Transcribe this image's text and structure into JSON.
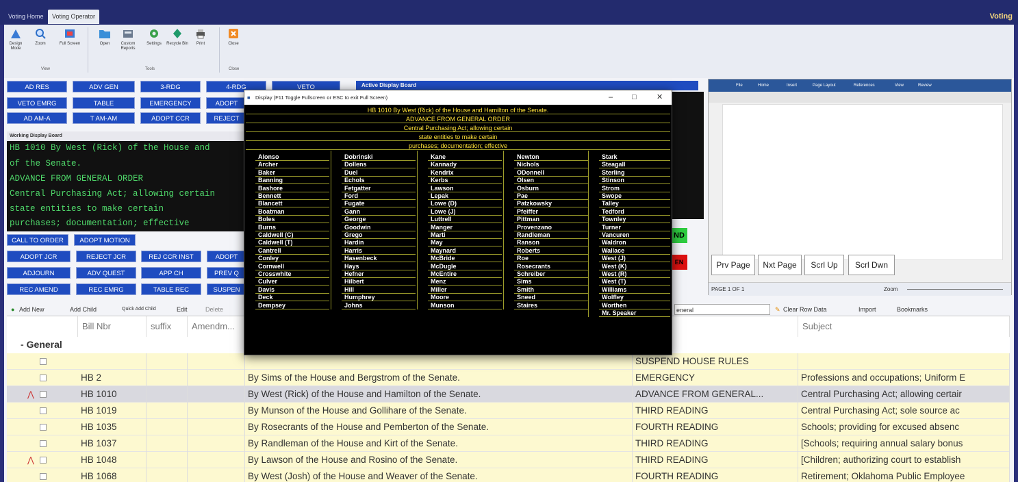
{
  "tabs": [
    "Voting Home",
    "Voting Operator"
  ],
  "app_label": "Voting",
  "ribbon": {
    "buttons": [
      {
        "label": "Design Mode",
        "icon": "design-icon"
      },
      {
        "label": "Zoom",
        "icon": "zoom-icon"
      },
      {
        "label": "Full Screen",
        "icon": "fullscreen-icon"
      },
      {
        "label": "Open",
        "icon": "folder-icon"
      },
      {
        "label": "Custom Reports",
        "icon": "report-icon"
      },
      {
        "label": "Settings",
        "icon": "settings-icon"
      },
      {
        "label": "Recycle Bin",
        "icon": "recycle-icon"
      },
      {
        "label": "Print",
        "icon": "print-icon"
      },
      {
        "label": "Close",
        "icon": "close-icon"
      }
    ],
    "groups": [
      "View",
      "Tools",
      "Close"
    ]
  },
  "vote_buttons": {
    "row1": [
      "AD RES",
      "ADV GEN",
      "3-RDG",
      "4-RDG",
      "VETO"
    ],
    "row2": [
      "VETO EMRG",
      "TABLE",
      "EMERGENCY",
      "ADOPT"
    ],
    "row3": [
      "AD AM-A",
      "T AM-AM",
      "ADOPT CCR",
      "REJECT"
    ],
    "row4": [
      "CALL TO ORDER",
      "ADOPT MOTION"
    ],
    "row5": [
      "ADOPT JCR",
      "REJECT JCR",
      "REJ CCR INST",
      "ADOPT"
    ],
    "row6": [
      "ADJOURN",
      "ADV QUEST",
      "APP CH",
      "PREV Q"
    ],
    "row7": [
      "REC AMEND",
      "REC EMRG",
      "TABLE REC",
      "SUSPEN"
    ],
    "side_green": "ND",
    "side_red": "EN"
  },
  "working_display": {
    "title": "Working Display Board",
    "lines": [
      "HB 1010  By West (Rick) of the House and",
      "of the Senate.",
      "ADVANCE FROM GENERAL ORDER",
      "Central Purchasing Act; allowing certain",
      "state entities to make certain",
      "purchases; documentation; effective"
    ]
  },
  "active_display_title": "Active Display Board",
  "word": {
    "menu": [
      "File",
      "Home",
      "Insert",
      "Page Layout",
      "References",
      "View",
      "Review"
    ],
    "nav": [
      "Prv Page",
      "Nxt Page",
      "Scrl Up",
      "Scrl Dwn"
    ],
    "page_status": "PAGE 1 OF 1",
    "zoom_label": "Zoom"
  },
  "display_window": {
    "title": "Display (F11 Toggle Fullscreen or ESC to exit Full Screen)",
    "header_lines": [
      "HB 1010  By West (Rick) of the House and Hamilton of the Senate.",
      "ADVANCE FROM GENERAL ORDER",
      "Central Purchasing Act; allowing certain",
      "state entities to make certain",
      "purchases; documentation; effective"
    ],
    "columns": [
      [
        "Alonso",
        "Archer",
        "Baker",
        "Banning",
        "Bashore",
        "Bennett",
        "Blancett",
        "Boatman",
        "Boles",
        "Burns",
        "Caldwell (C)",
        "Caldwell (T)",
        "Cantrell",
        "Conley",
        "Cornwell",
        "Crosswhite",
        "Culver",
        "Davis",
        "Deck",
        "Dempsey"
      ],
      [
        "Dobrinski",
        "Dollens",
        "Duel",
        "Echols",
        "Fetgatter",
        "Ford",
        "Fugate",
        "Gann",
        "George",
        "Goodwin",
        "Grego",
        "Hardin",
        "Harris",
        "Hasenbeck",
        "Hays",
        "Hefner",
        "Hilbert",
        "Hill",
        "Humphrey",
        "Johns"
      ],
      [
        "Kane",
        "Kannady",
        "Kendrix",
        "Kerbs",
        "Lawson",
        "Lepak",
        "Lowe (D)",
        "Lowe (J)",
        "Luttrell",
        "Manger",
        "Marti",
        "May",
        "Maynard",
        "McBride",
        "McDugle",
        "McEntire",
        "Menz",
        "Miller",
        "Moore",
        "Munson"
      ],
      [
        "Newton",
        "Nichols",
        "ODonnell",
        "Olsen",
        "Osburn",
        "Pae",
        "Patzkowsky",
        "Pfeiffer",
        "Pittman",
        "Provenzano",
        "Randleman",
        "Ranson",
        "Roberts",
        "Roe",
        "Rosecrants",
        "Schreiber",
        "Sims",
        "Smith",
        "Sneed",
        "Staires"
      ],
      [
        "Stark",
        "Steagall",
        "Sterling",
        "Stinson",
        "Strom",
        "Swope",
        "Talley",
        "Tedford",
        "Townley",
        "Turner",
        "Vancuren",
        "Waldron",
        "Wallace",
        "West (J)",
        "West (K)",
        "West (R)",
        "West (T)",
        "Williams",
        "Wolfley",
        "Worthen",
        "Mr. Speaker"
      ]
    ]
  },
  "grid_toolbar": {
    "add_new": "Add New",
    "add_child": "Add Child",
    "quick_add": "Quick Add Child",
    "edit": "Edit",
    "delete": "Delete",
    "filter_value": "eneral",
    "clear_row": "Clear Row Data",
    "import": "Import",
    "bookmarks": "Bookmarks"
  },
  "grid": {
    "columns": [
      "Bill Nbr",
      "suffix",
      "Amendm...",
      "",
      "",
      "Subject"
    ],
    "group": "General",
    "rows": [
      {
        "bill": "",
        "desc": "",
        "status": "SUSPEND HOUSE RULES",
        "subject": ""
      },
      {
        "bill": "HB 2",
        "desc": "By Sims of the House and Bergstrom of the Senate.",
        "status": "EMERGENCY",
        "subject": "Professions and occupations; Uniform E"
      },
      {
        "bill": "HB 1010",
        "desc": "By West (Rick) of the House and Hamilton of the Senate.",
        "status": "ADVANCE FROM GENERAL...",
        "subject": "Central Purchasing Act; allowing certair"
      },
      {
        "bill": "HB 1019",
        "desc": "By Munson of the House and Gollihare of the Senate.",
        "status": "THIRD READING",
        "subject": "Central Purchasing Act; sole source ac"
      },
      {
        "bill": "HB 1035",
        "desc": "By Rosecrants of the House and Pemberton of the Senate.",
        "status": "FOURTH READING",
        "subject": "Schools; providing for excused absenc"
      },
      {
        "bill": "HB 1037",
        "desc": "By Randleman of the House and Kirt of the Senate.",
        "status": "THIRD READING",
        "subject": "[Schools; requiring annual salary bonus"
      },
      {
        "bill": "HB 1048",
        "desc": "By Lawson of the House and Rosino of the Senate.",
        "status": "THIRD READING",
        "subject": "[Children; authorizing court to establish"
      },
      {
        "bill": "HB 1068",
        "desc": "By West (Josh) of the House and Weaver of the Senate.",
        "status": "FOURTH READING",
        "subject": "Retirement; Oklahoma Public Employee"
      }
    ]
  },
  "colors": {
    "accent": "#1f4cc0",
    "green_text": "#4fd86a",
    "yellow_text": "#ffe23a",
    "row_yellow": "#fdf9d0",
    "row_selected": "#d9d9df"
  }
}
